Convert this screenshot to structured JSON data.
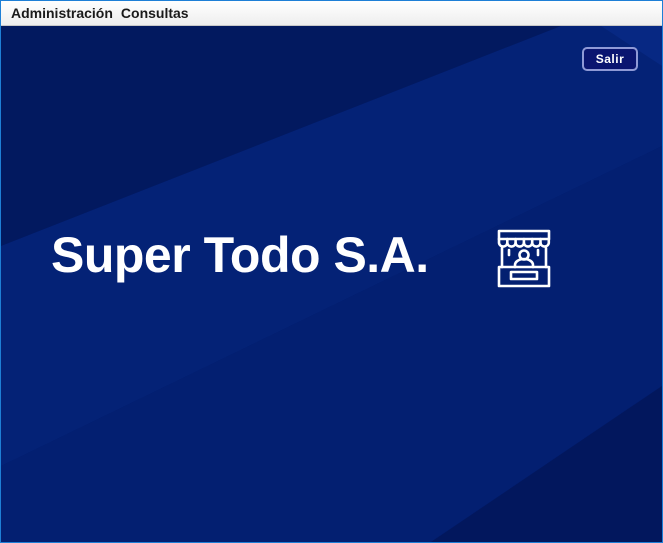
{
  "menubar": {
    "items": [
      {
        "label": "Administración"
      },
      {
        "label": "Consultas"
      }
    ]
  },
  "main": {
    "title": "Super Todo S.A.",
    "exit_label": "Salir",
    "logo_icon": "store-kiosk-icon"
  },
  "colors": {
    "background": "#031e6e",
    "text": "#ffffff",
    "button_bg": "#0a1570",
    "button_border": "#8f9ad6",
    "window_border": "#1e7fd6"
  }
}
